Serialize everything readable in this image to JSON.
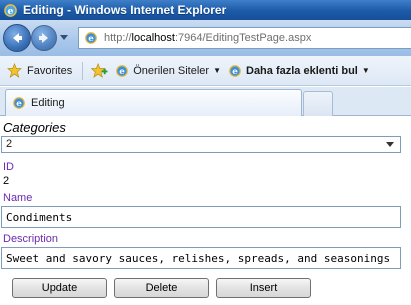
{
  "window": {
    "title": "Editing - Windows Internet Explorer"
  },
  "address_bar": {
    "url_prefix": "http://",
    "url_host": "localhost",
    "url_rest": ":7964/EditingTestPage.aspx"
  },
  "favorites_bar": {
    "favorites_label": "Favorites",
    "suggested_sites_label": "Önerilen Siteler",
    "more_addons_label": "Daha fazla eklenti bul"
  },
  "tab": {
    "label": "Editing"
  },
  "form": {
    "categories_label": "Categories",
    "categories_selected": "2",
    "id_label": "ID",
    "id_value": "2",
    "name_label": "Name",
    "name_value": "Condiments",
    "description_label": "Description",
    "description_value": "Sweet and savory sauces, relishes, spreads, and seasonings"
  },
  "buttons": {
    "update": "Update",
    "delete": "Delete",
    "insert": "Insert"
  },
  "colors": {
    "field_label": "#6a2ab0",
    "titlebar": "#1c5aa8"
  }
}
